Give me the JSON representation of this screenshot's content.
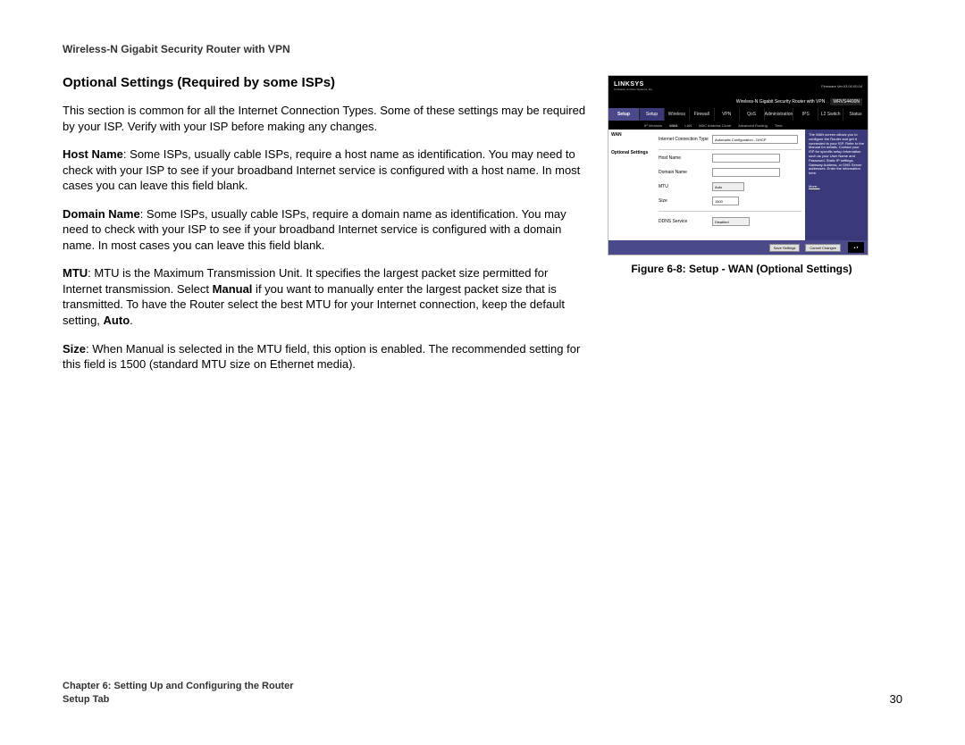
{
  "header": {
    "product": "Wireless-N Gigabit Security Router with VPN"
  },
  "section": {
    "heading": "Optional Settings (Required by some ISPs)"
  },
  "paras": {
    "intro": "This section is common for all the Internet Connection Types. Some of these settings may be required by your ISP. Verify with your ISP before making any changes.",
    "host_lead": "Host Name",
    "host_body": ": Some ISPs, usually cable ISPs, require a host name as identification. You may need to check with your ISP to see if your broadband Internet service is configured with a host name. In most cases you can leave this field blank.",
    "domain_lead": "Domain Name",
    "domain_body": ": Some ISPs, usually cable ISPs, require a domain name as identification. You may need to check with your ISP to see if your broadband Internet service is configured with a domain name. In most cases you can leave this field blank.",
    "mtu_lead": "MTU",
    "mtu_body_a": ": MTU is the Maximum Transmission Unit. It specifies the largest packet size permitted for Internet transmission. Select ",
    "mtu_manual": "Manual",
    "mtu_body_b": " if you want to manually enter the largest packet size that is transmitted. To have the Router select the best MTU for your Internet connection, keep the default setting, ",
    "mtu_auto": "Auto",
    "mtu_body_c": ".",
    "size_lead": "Size",
    "size_body": ": When Manual is selected in the MTU field, this option is enabled. The recommended setting for this field is 1500 (standard MTU size on Ethernet media)."
  },
  "figure": {
    "caption": "Figure 6-8: Setup - WAN (Optional Settings)",
    "ui": {
      "brand": "LINKSYS",
      "subbrand": "A Division of Cisco Systems, Inc.",
      "fw": "Firmware Ver.03.00.00.04",
      "bar2_title": "Wireless-N Gigabit Security Router with VPN",
      "bar2_model": "WRVS4400N",
      "side_tab": "Setup",
      "tabs": [
        "Setup",
        "Wireless",
        "Firewall",
        "VPN",
        "QoS",
        "Administration",
        "IPS",
        "L2 Switch",
        "Status"
      ],
      "subtabs": [
        "IP Versions",
        "WAN",
        "LAN",
        "MAC Address Clone",
        "Advanced Routing",
        "Time"
      ],
      "side_labels": {
        "wan": "WAN",
        "opt": "Optional Settings"
      },
      "rows": {
        "conn_label": "Internet Connection Type",
        "conn_value": "Automatic Configuration - DHCP",
        "host_label": "Host Name",
        "domain_label": "Domain Name",
        "mtu_label": "MTU",
        "mtu_value": "Auto",
        "size_label": "Size",
        "size_value": "1500",
        "ddns_label": "DDNS Service",
        "ddns_value": "Disabled"
      },
      "help": {
        "text": "The WAN screen allows you to configure the Router and get it connected to your ISP. Refer to the Manual for details. Contact your ISP for specific setup information such as your User Name and Password, Static IP settings, Gateway Address, or DNS Server addresses. Enter the information here.",
        "more": "More..."
      },
      "buttons": {
        "save": "Save Settings",
        "cancel": "Cancel Changes"
      }
    }
  },
  "footer": {
    "chapter": "Chapter 6: Setting Up and Configuring the Router",
    "tab": "Setup Tab",
    "page": "30"
  }
}
